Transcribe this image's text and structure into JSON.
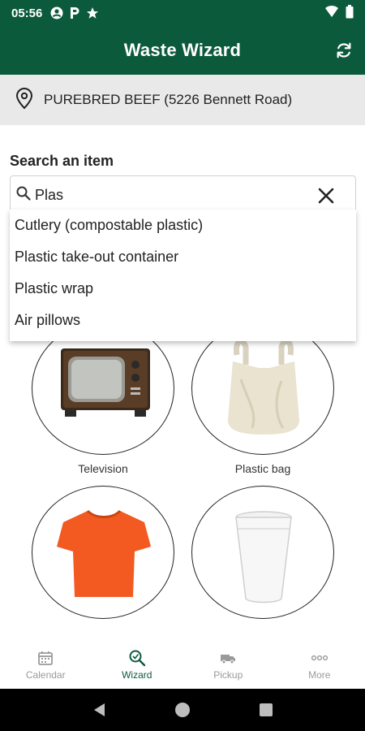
{
  "status_bar": {
    "time": "05:56",
    "left_icons": [
      "account-circle-icon",
      "parking-icon",
      "star-icon"
    ],
    "right_icons": [
      "wifi-icon",
      "battery-icon"
    ]
  },
  "app_bar": {
    "title": "Waste Wizard",
    "refresh_icon": "refresh-icon"
  },
  "location": {
    "icon": "location-pin-icon",
    "text": "PUREBRED BEEF (5226 Bennett Road)"
  },
  "search": {
    "label": "Search an item",
    "value": "Plas",
    "suggestions": [
      "Cutlery (compostable plastic)",
      "Plastic take-out container",
      "Plastic wrap",
      "Air pillows"
    ]
  },
  "items": [
    {
      "label": "Television",
      "image": "television"
    },
    {
      "label": "Plastic bag",
      "image": "plastic-bag"
    },
    {
      "label": "",
      "image": "t-shirt"
    },
    {
      "label": "",
      "image": "foam-cup"
    }
  ],
  "bottom_nav": [
    {
      "label": "Calendar",
      "icon": "calendar-icon",
      "active": false
    },
    {
      "label": "Wizard",
      "icon": "wizard-search-icon",
      "active": true
    },
    {
      "label": "Pickup",
      "icon": "truck-icon",
      "active": false
    },
    {
      "label": "More",
      "icon": "more-dots-icon",
      "active": false
    }
  ],
  "colors": {
    "primary": "#0c5a3c",
    "location_bg": "#e9e9e9",
    "inactive": "#9a9a9a"
  }
}
